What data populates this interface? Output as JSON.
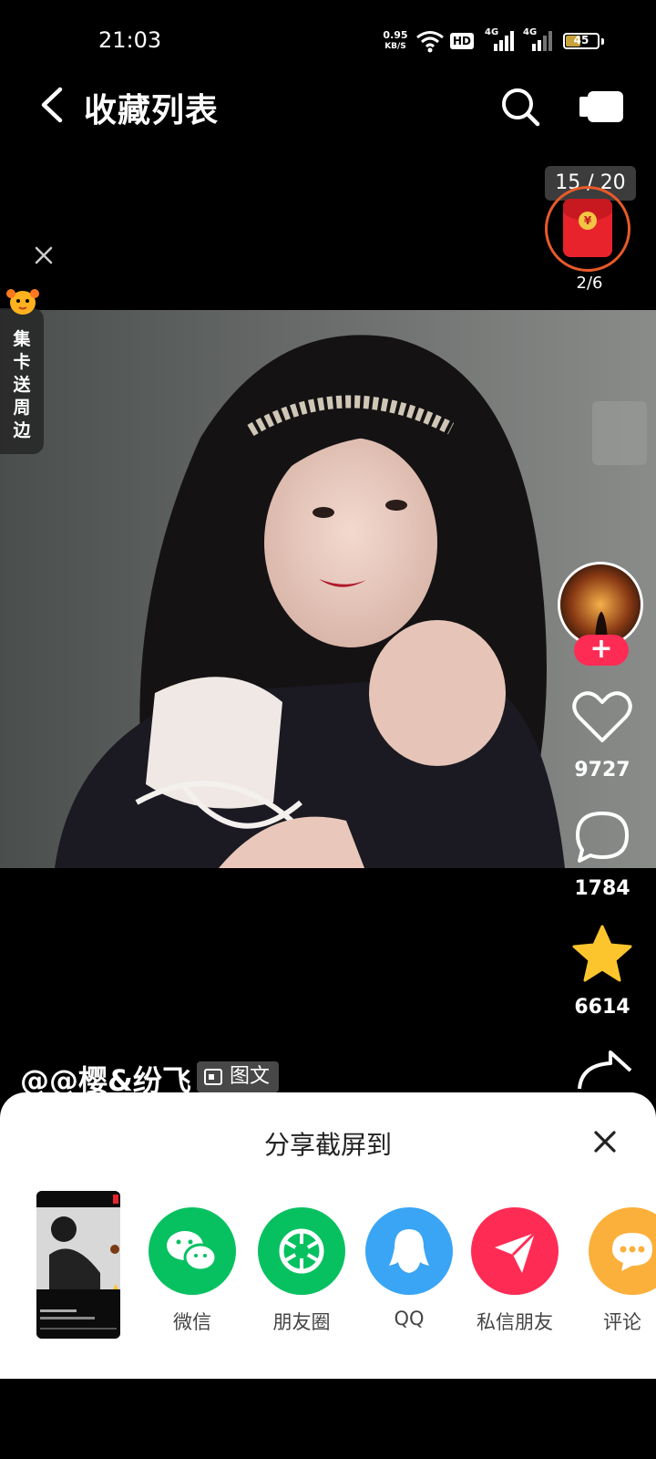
{
  "status_bar": {
    "time": "21:03",
    "net_speed": "0.95",
    "net_unit": "KB/S",
    "hd": "HD",
    "signal1": "4G",
    "signal2": "4G",
    "battery": "45",
    "battery_level": 0.45
  },
  "header": {
    "title": "收藏列表",
    "icons": [
      "back-arrow-icon",
      "search-icon",
      "video-camera-icon"
    ]
  },
  "counter": "15 / 20",
  "red_packet": {
    "count": "2/6"
  },
  "card_badge": {
    "text": "集卡送周边"
  },
  "rail": {
    "likes": "9727",
    "comments": "1784",
    "favorites": "6614",
    "follow_symbol": "+"
  },
  "author": {
    "name": "@@樱&纷飞",
    "tag": "图文"
  },
  "share_sheet": {
    "title": "分享截屏到",
    "items": [
      {
        "label": "微信",
        "color": "#07c160"
      },
      {
        "label": "朋友圈",
        "color": "#07c160"
      },
      {
        "label": "QQ",
        "color": "#3aa5f5"
      },
      {
        "label": "私信朋友",
        "color": "#fe2c55"
      },
      {
        "label": "评论",
        "color": "#fbb03b"
      }
    ]
  }
}
